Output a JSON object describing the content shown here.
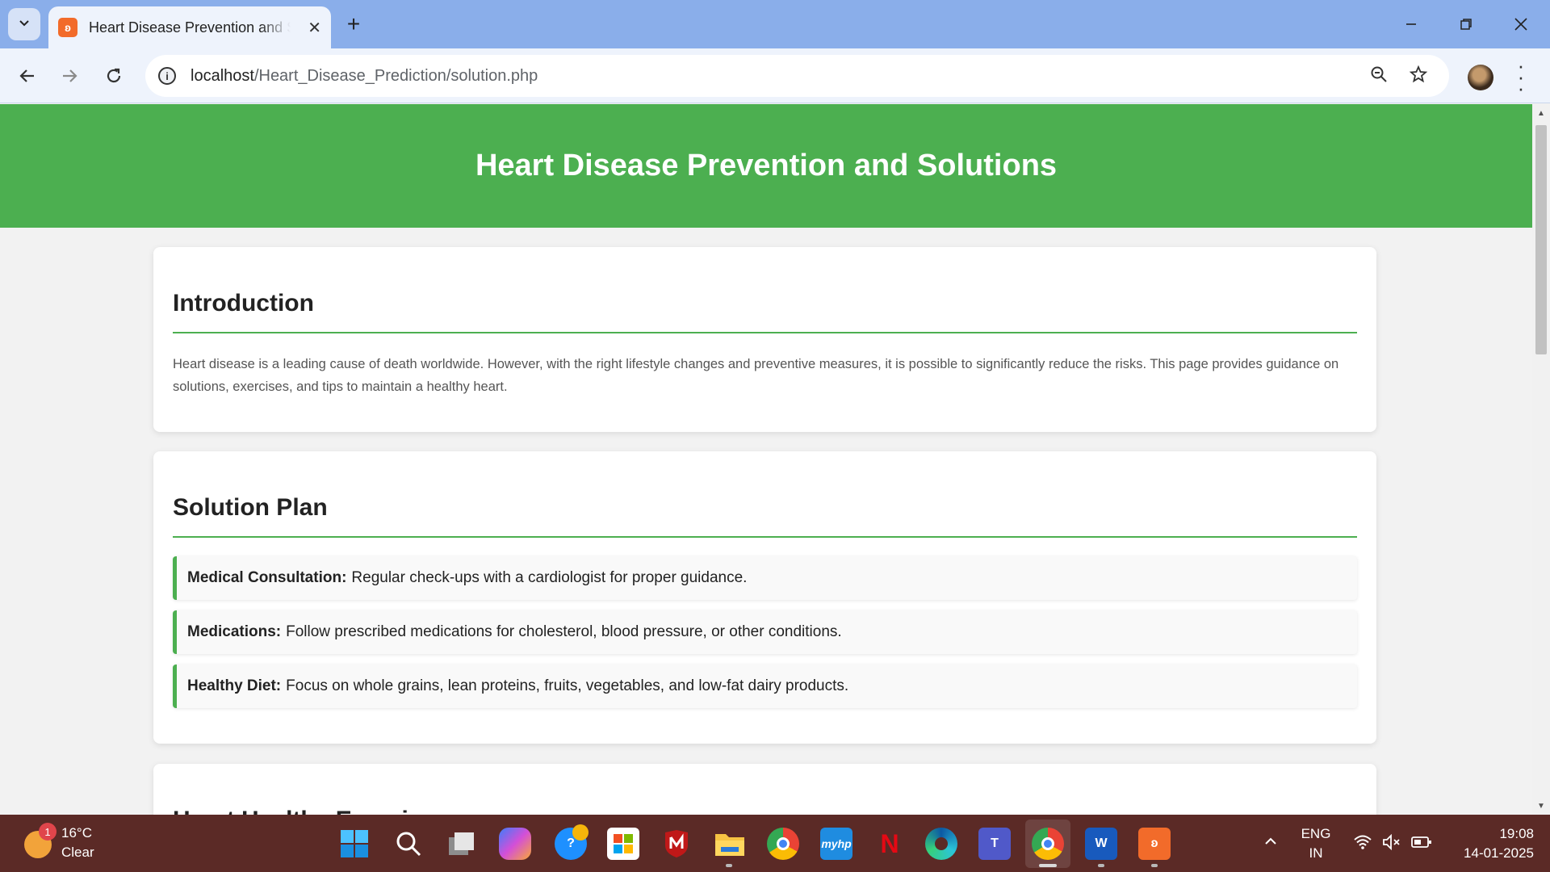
{
  "browser": {
    "tab_title": "Heart Disease Prevention and Solutions",
    "new_tab_symbol": "+",
    "close_symbol": "✕",
    "url_host": "localhost",
    "url_path": "/Heart_Disease_Prediction/solution.php",
    "window_controls": {
      "minimize": "—",
      "restore": "❐",
      "close": "✕"
    },
    "icons": [
      "tab-search-icon",
      "back-arrow-icon",
      "forward-arrow-icon",
      "reload-icon",
      "site-info-icon",
      "zoom-icon",
      "bookmark-star-icon",
      "profile-avatar",
      "menu-dots-icon"
    ]
  },
  "page": {
    "header_title": "Heart Disease Prevention and Solutions",
    "header_color": "#4caf50",
    "introduction": {
      "heading": "Introduction",
      "text": "Heart disease is a leading cause of death worldwide. However, with the right lifestyle changes and preventive measures, it is possible to significantly reduce the risks. This page provides guidance on solutions, exercises, and tips to maintain a healthy heart."
    },
    "solution_plan": {
      "heading": "Solution Plan",
      "items": [
        {
          "label": "Medical Consultation:",
          "text": "Regular check-ups with a cardiologist for proper guidance."
        },
        {
          "label": "Medications:",
          "text": "Follow prescribed medications for cholesterol, blood pressure, or other conditions."
        },
        {
          "label": "Healthy Diet:",
          "text": "Focus on whole grains, lean proteins, fruits, vegetables, and low-fat dairy products."
        }
      ]
    },
    "next_section_heading": "Heart Healthy Exercises"
  },
  "taskbar": {
    "weather_badge": "1",
    "temperature": "16°C",
    "condition": "Clear",
    "language_top": "ENG",
    "language_bottom": "IN",
    "time": "19:08",
    "date": "14-01-2025",
    "apps": [
      "start-icon",
      "search-icon",
      "task-view-icon",
      "copilot-icon",
      "help-icon",
      "store-icon",
      "mcafee-icon",
      "file-explorer-icon",
      "chrome-profile-icon",
      "myhp-icon",
      "netflix-icon",
      "edge-icon",
      "teams-icon",
      "chrome-icon",
      "word-icon",
      "xampp-icon"
    ]
  }
}
